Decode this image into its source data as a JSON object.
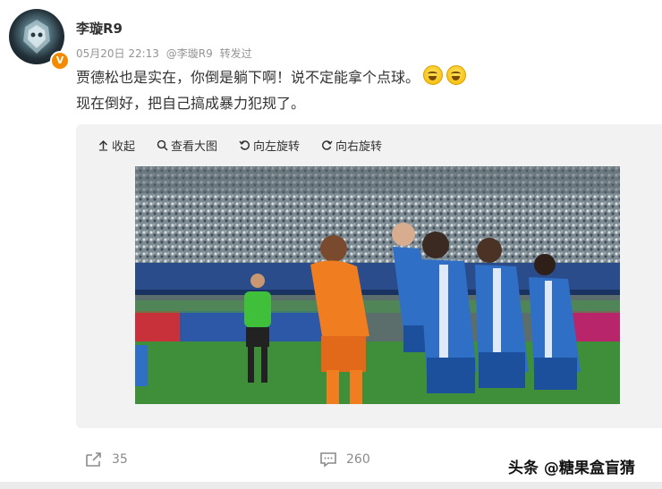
{
  "post": {
    "author": "李璇R9",
    "timestamp": "05月20日 22:13",
    "repost_source": "@李璇R9",
    "repost_label": "转发过",
    "text_line1": "贾德松也是实在，你倒是躺下啊！说不定能拿个点球。",
    "text_line2": "现在倒好，把自己搞成暴力犯规了。",
    "verified_badge": "V"
  },
  "media_toolbar": {
    "collapse_label": "收起",
    "view_large_label": "查看大图",
    "rotate_left_label": "向左旋转",
    "rotate_right_label": "向右旋转"
  },
  "actions": {
    "share_count": "35",
    "comment_count": "260"
  },
  "watermark": "头条 @糖果盒盲猜",
  "icons": {
    "share": "share-icon",
    "comment": "comment-icon",
    "collapse": "arrow-up-icon",
    "view_large": "search-icon",
    "rotate_left": "rotate-left-icon",
    "rotate_right": "rotate-right-icon",
    "emoji": "laugh-cry-emoji-icon"
  },
  "colors": {
    "meta_gray": "#939393",
    "media_bg": "#f2f2f2",
    "verified_orange": "#f58a00",
    "team_orange": "#f07d1f",
    "team_blue": "#2f6fc6"
  }
}
